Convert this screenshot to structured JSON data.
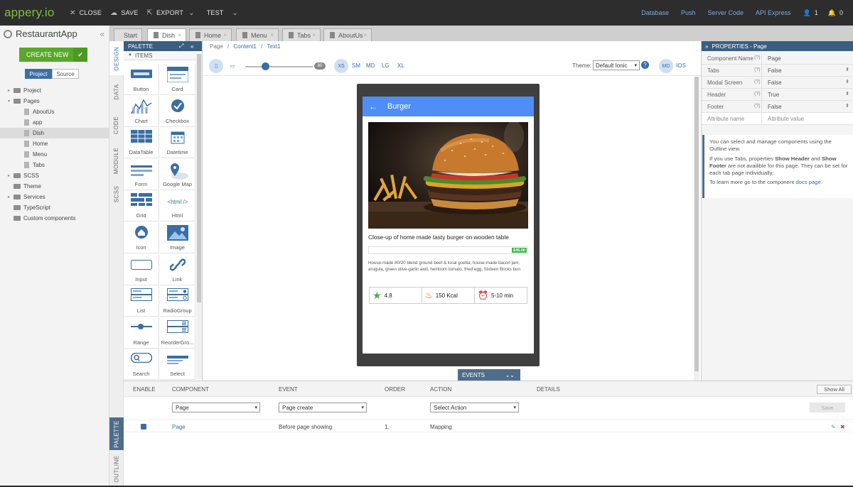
{
  "topbar": {
    "logo_main": "appery",
    "logo_ext": ".io",
    "close": "CLOSE",
    "save": "SAVE",
    "export": "EXPORT",
    "test": "TEST",
    "links": [
      "Database",
      "Push",
      "Server Code",
      "API Express"
    ],
    "user_count": "1",
    "notif_count": "0",
    "link_color": "#7aa9e6"
  },
  "project": {
    "name": "RestaurantApp",
    "create_new": "CREATE NEW",
    "tabs": [
      "Project",
      "Source"
    ],
    "tree": [
      {
        "label": "Project",
        "type": "folder",
        "level": 0,
        "expandable": true
      },
      {
        "label": "Pages",
        "type": "folder",
        "level": 0,
        "expanded": true
      },
      {
        "label": "AboutUs",
        "type": "page",
        "level": 1
      },
      {
        "label": "app",
        "type": "page",
        "level": 1
      },
      {
        "label": "Dish",
        "type": "page",
        "level": 1,
        "selected": true
      },
      {
        "label": "Home",
        "type": "page",
        "level": 1
      },
      {
        "label": "Menu",
        "type": "page",
        "level": 1
      },
      {
        "label": "Tabs",
        "type": "page",
        "level": 1
      },
      {
        "label": "SCSS",
        "type": "folder",
        "level": 0,
        "expandable": true
      },
      {
        "label": "Theme",
        "type": "folder",
        "level": 0
      },
      {
        "label": "Services",
        "type": "folder",
        "level": 0,
        "expandable": true
      },
      {
        "label": "TypeScript",
        "type": "folder",
        "level": 0
      },
      {
        "label": "Custom components",
        "type": "folder",
        "level": 0
      }
    ]
  },
  "side_tabs": [
    "DESIGN",
    "DATA",
    "CODE",
    "MODULE",
    "SCSS",
    "PALETTE",
    "OUTLINE"
  ],
  "editor_tabs": [
    "Start",
    "Dish",
    "Home",
    "Menu",
    "Tabs",
    "AboutUs"
  ],
  "palette": {
    "title": "PALETTE",
    "section": "ITEMS",
    "items": [
      "Button",
      "Card",
      "Chart",
      "Checkbox",
      "DataTable",
      "Datetime",
      "Form",
      "Google Map",
      "Grid",
      "Html",
      "Icon",
      "Image",
      "Input",
      "Link",
      "List",
      "RadioGroup",
      "Range",
      "ReorderGro...",
      "Search",
      "Select"
    ]
  },
  "canvas": {
    "breadcrumb": [
      "Page",
      "Content1",
      "Text1"
    ],
    "slider_value": "80",
    "breakpoints": [
      "XS",
      "SM",
      "MD",
      "LG",
      "XL"
    ],
    "theme_label": "Theme:",
    "theme_value": "Default Ionic",
    "platform": [
      "MD",
      "IOS"
    ],
    "events_tab": "EVENTS"
  },
  "app_screen": {
    "header_title": "Burger",
    "title": "Close-up of home made tasty burger on wooden table",
    "price": "$45.00",
    "description": "House-made 80/20 blend ground beef & local goetta, house-made bacon jam, arugula, green olive-garlic aioli, heirloom tomato, fried egg, Sixteen Bricks bun",
    "rating": "4.8",
    "calories": "150 Kcal",
    "time": "5-10 min",
    "header_color": "#4f8ef7"
  },
  "properties": {
    "title": "PROPERTIES - Page",
    "rows": [
      {
        "key": "Component Name",
        "value": "Page"
      },
      {
        "key": "Tabs",
        "value": "False"
      },
      {
        "key": "Modal Screen",
        "value": "False"
      },
      {
        "key": "Header",
        "value": "True"
      },
      {
        "key": "Footer",
        "value": "False"
      }
    ],
    "attr_name": "Attribute name",
    "attr_value": "Attribute value",
    "info1": "You can select and manage components using the Outline view.",
    "info2a": "If you use Tabs, properties ",
    "info2b": "Show Header",
    "info2c": " and ",
    "info2d": "Show Footer",
    "info2e": " are not availible for this page. They can be set for each tab page individually;",
    "info3a": "To learn more go to the component ",
    "info3b": "docs page",
    "info3c": "."
  },
  "events": {
    "columns": [
      "ENABLE",
      "COMPONENT",
      "EVENT",
      "ORDER",
      "ACTION",
      "DETAILS"
    ],
    "show_all": "Show All",
    "component_select": "Page",
    "event_select": "Page create",
    "action_select": "Select Action",
    "save": "Save",
    "row": {
      "component": "Page",
      "event": "Before page showing",
      "order": "1.",
      "action": "Mapping"
    }
  }
}
